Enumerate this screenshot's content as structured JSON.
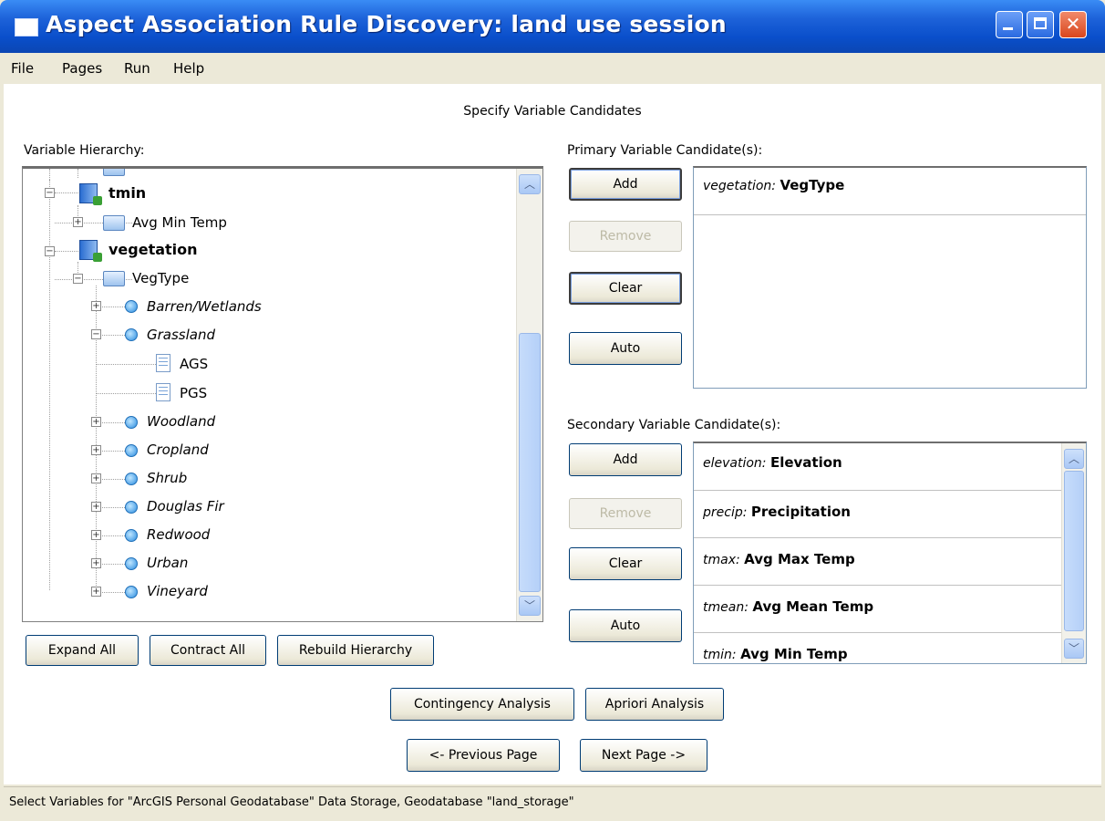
{
  "window": {
    "title": "Aspect Association Rule Discovery: land use session"
  },
  "menu": [
    "File",
    "Pages",
    "Run",
    "Help"
  ],
  "page_heading": "Specify Variable Candidates",
  "hierarchy": {
    "label": "Variable Hierarchy:",
    "nodes": [
      {
        "text": "tmin",
        "style": "bold",
        "icon": "database-icon"
      },
      {
        "text": "Avg Min Temp",
        "style": "normal",
        "icon": "folder-icon"
      },
      {
        "text": "vegetation",
        "style": "bold",
        "icon": "database-icon"
      },
      {
        "text": "VegType",
        "style": "normal",
        "icon": "folder-open-icon"
      },
      {
        "text": "Barren/Wetlands",
        "style": "italic",
        "icon": "category-icon"
      },
      {
        "text": "Grassland",
        "style": "italic",
        "icon": "category-icon"
      },
      {
        "text": "AGS",
        "style": "normal",
        "icon": "document-icon"
      },
      {
        "text": "PGS",
        "style": "normal",
        "icon": "document-icon"
      },
      {
        "text": "Woodland",
        "style": "italic",
        "icon": "category-icon"
      },
      {
        "text": "Cropland",
        "style": "italic",
        "icon": "category-icon"
      },
      {
        "text": "Shrub",
        "style": "italic",
        "icon": "category-icon"
      },
      {
        "text": "Douglas Fir",
        "style": "italic",
        "icon": "category-icon"
      },
      {
        "text": "Redwood",
        "style": "italic",
        "icon": "category-icon"
      },
      {
        "text": "Urban",
        "style": "italic",
        "icon": "category-icon"
      },
      {
        "text": "Vineyard",
        "style": "italic",
        "icon": "category-icon"
      }
    ],
    "buttons": {
      "expand_all": "Expand All",
      "contract_all": "Contract All",
      "rebuild": "Rebuild Hierarchy"
    }
  },
  "primary": {
    "label": "Primary Variable Candidate(s):",
    "buttons": {
      "add": "Add",
      "remove": "Remove",
      "clear": "Clear",
      "auto": "Auto"
    },
    "items": [
      {
        "prefix": "vegetation:",
        "name": "VegType"
      }
    ]
  },
  "secondary": {
    "label": "Secondary Variable Candidate(s):",
    "buttons": {
      "add": "Add",
      "remove": "Remove",
      "clear": "Clear",
      "auto": "Auto"
    },
    "items": [
      {
        "prefix": "elevation:",
        "name": "Elevation"
      },
      {
        "prefix": "precip:",
        "name": "Precipitation"
      },
      {
        "prefix": "tmax:",
        "name": "Avg Max Temp"
      },
      {
        "prefix": "tmean:",
        "name": "Avg Mean Temp"
      },
      {
        "prefix": "tmin:",
        "name": "Avg Min Temp"
      }
    ]
  },
  "analysis": {
    "contingency": "Contingency Analysis",
    "apriori": "Apriori Analysis"
  },
  "navigation": {
    "previous": "<- Previous Page",
    "next": "Next Page ->"
  },
  "status": "Select Variables for \"ArcGIS Personal Geodatabase\" Data Storage, Geodatabase \"land_storage\""
}
